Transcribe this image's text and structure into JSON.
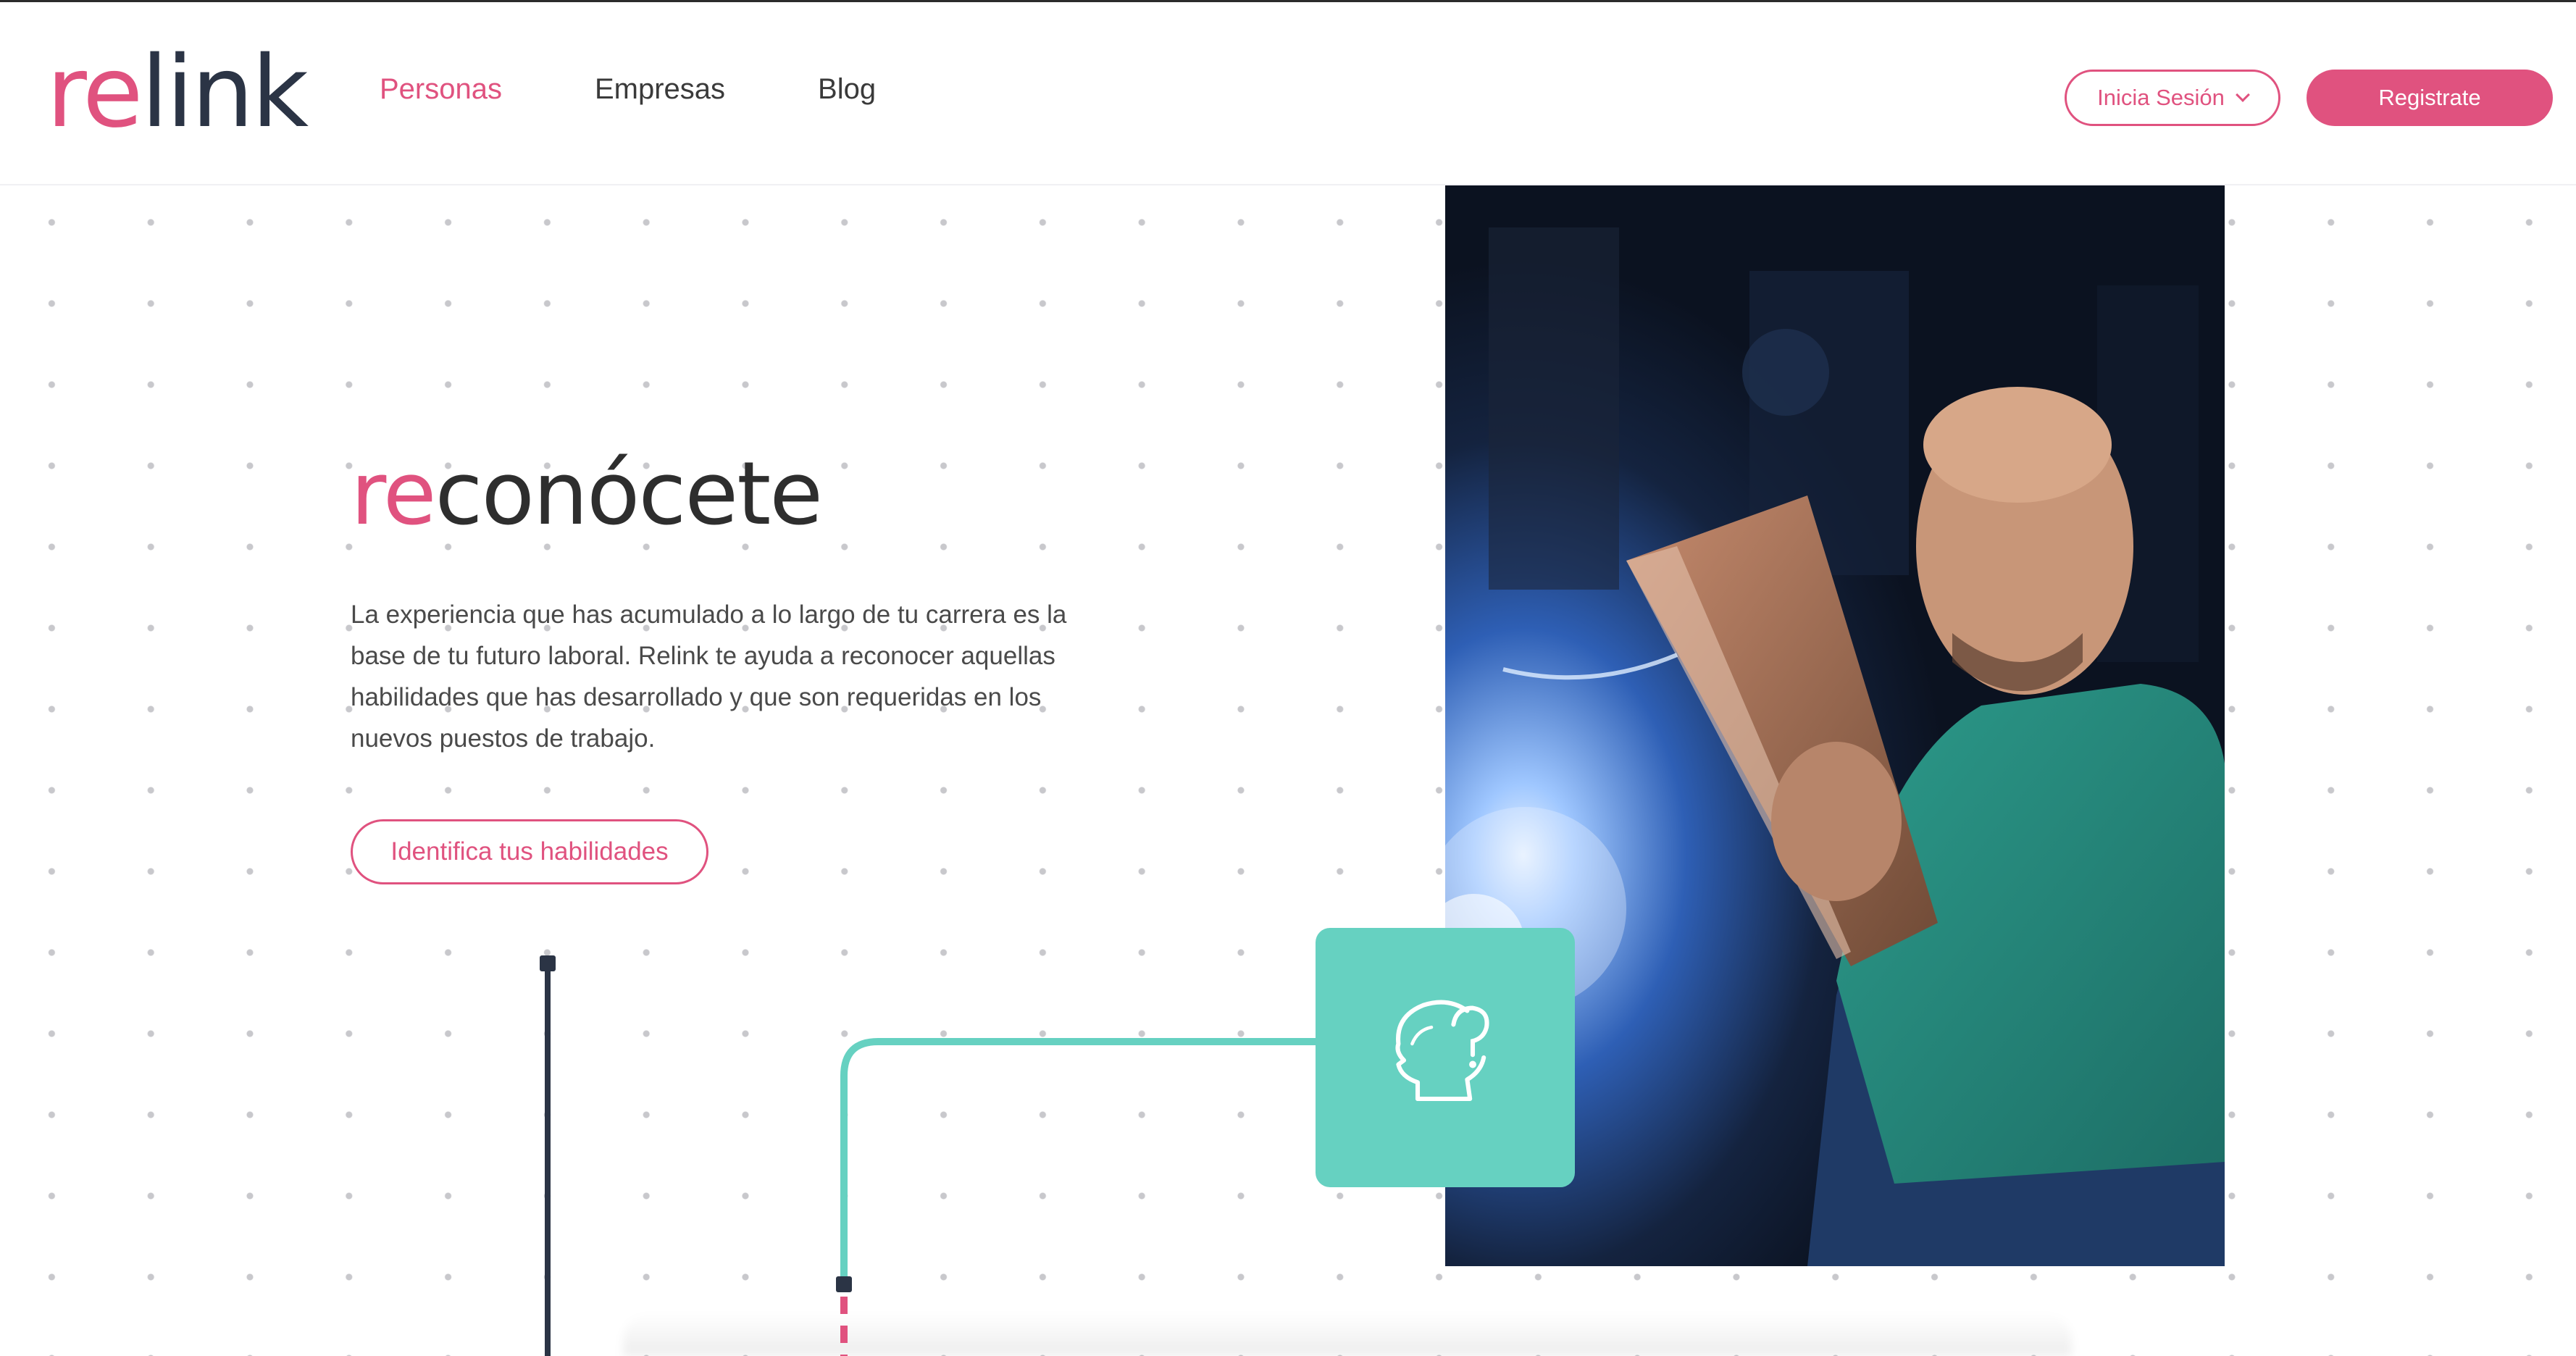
{
  "header": {
    "logo": {
      "prefix": "re",
      "suffix": "link"
    },
    "nav": [
      "Personas",
      "Empresas",
      "Blog"
    ],
    "login_label": "Inicia Sesión",
    "register_label": "Registrate"
  },
  "hero": {
    "title_prefix": "re",
    "title_rest": "conócete",
    "description": "La experiencia que has acumulado a lo largo de tu carrera es la base de tu futuro laboral. Relink te ayuda a reconocer aquellas habilidades que has desarrollado y que son requeridas en los nuevos puestos de trabajo.",
    "cta_label": "Identifica tus habilidades"
  },
  "icons": {
    "card_icon": "head-question-icon",
    "login_chevron": "chevron-down-icon"
  },
  "colors": {
    "brand_pink": "#e0527f",
    "navy": "#2b3445",
    "teal": "#66d1c1",
    "text": "#4a4a4a"
  }
}
